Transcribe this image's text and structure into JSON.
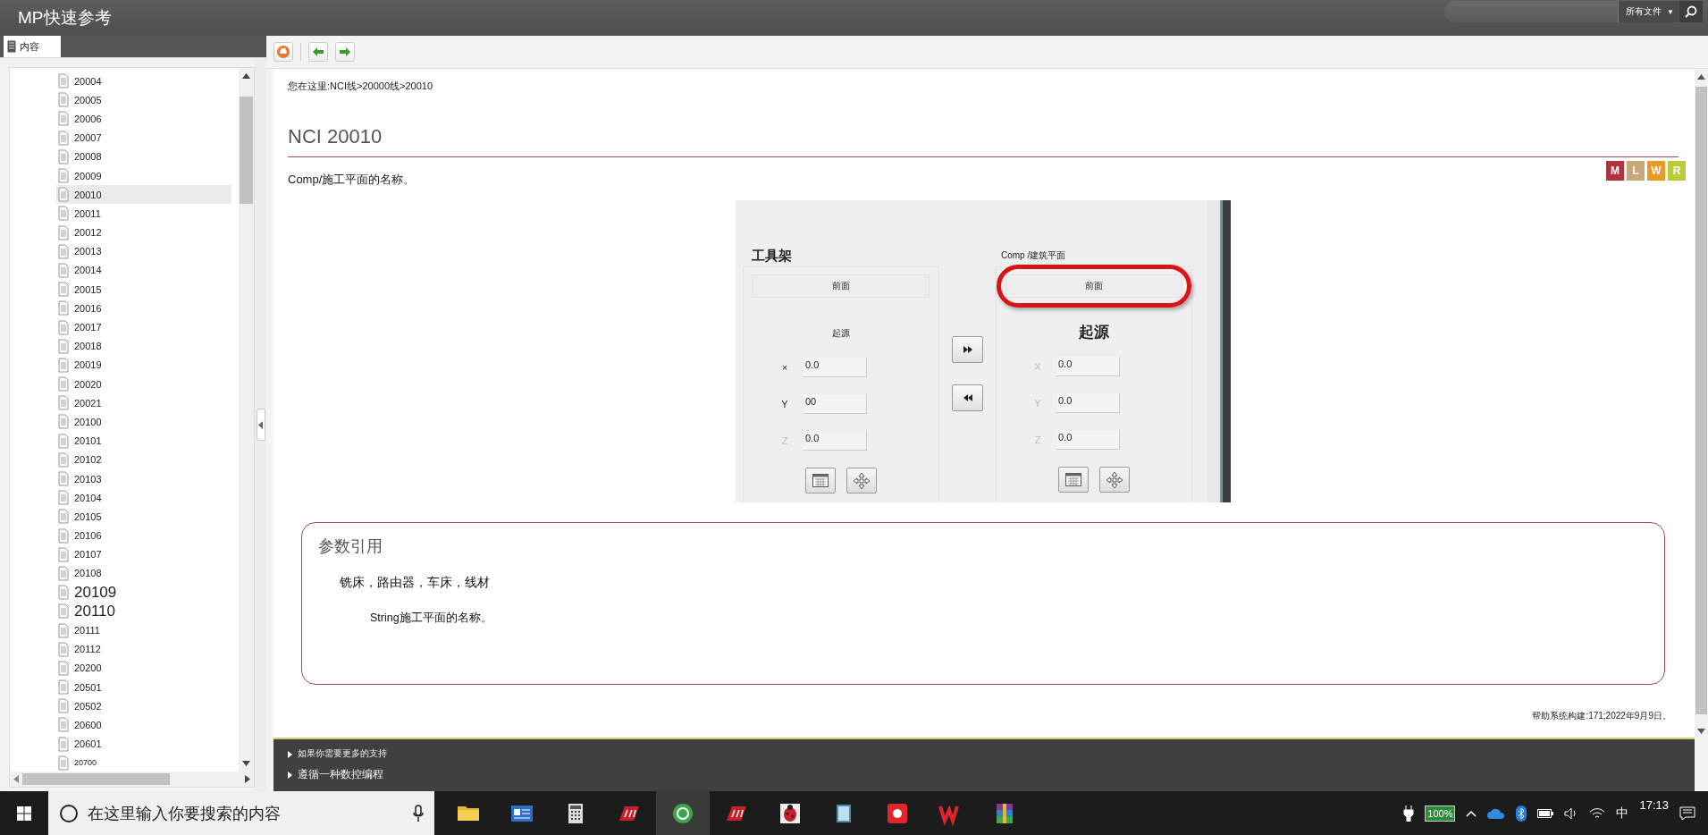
{
  "app": {
    "title": "MP快速参考"
  },
  "search": {
    "scope": "所有文件",
    "caret": "▼"
  },
  "left_tabs": [
    {
      "label": "内容",
      "selected": true
    }
  ],
  "tree": {
    "items": [
      {
        "label": "20004",
        "selected": false,
        "kind": "normal"
      },
      {
        "label": "20005",
        "selected": false,
        "kind": "normal"
      },
      {
        "label": "20006",
        "selected": false,
        "kind": "normal"
      },
      {
        "label": "20007",
        "selected": false,
        "kind": "normal"
      },
      {
        "label": "20008",
        "selected": false,
        "kind": "normal"
      },
      {
        "label": "20009",
        "selected": false,
        "kind": "normal"
      },
      {
        "label": "20010",
        "selected": true,
        "kind": "normal"
      },
      {
        "label": "20011",
        "selected": false,
        "kind": "normal"
      },
      {
        "label": "20012",
        "selected": false,
        "kind": "normal"
      },
      {
        "label": "20013",
        "selected": false,
        "kind": "normal"
      },
      {
        "label": "20014",
        "selected": false,
        "kind": "normal"
      },
      {
        "label": "20015",
        "selected": false,
        "kind": "normal"
      },
      {
        "label": "20016",
        "selected": false,
        "kind": "normal"
      },
      {
        "label": "20017",
        "selected": false,
        "kind": "normal"
      },
      {
        "label": "20018",
        "selected": false,
        "kind": "normal"
      },
      {
        "label": "20019",
        "selected": false,
        "kind": "normal"
      },
      {
        "label": "20020",
        "selected": false,
        "kind": "normal"
      },
      {
        "label": "20021",
        "selected": false,
        "kind": "normal"
      },
      {
        "label": "20100",
        "selected": false,
        "kind": "normal"
      },
      {
        "label": "20101",
        "selected": false,
        "kind": "normal"
      },
      {
        "label": "20102",
        "selected": false,
        "kind": "normal"
      },
      {
        "label": "20103",
        "selected": false,
        "kind": "normal"
      },
      {
        "label": "20104",
        "selected": false,
        "kind": "normal"
      },
      {
        "label": "20105",
        "selected": false,
        "kind": "normal"
      },
      {
        "label": "20106",
        "selected": false,
        "kind": "normal"
      },
      {
        "label": "20107",
        "selected": false,
        "kind": "normal"
      },
      {
        "label": "20108",
        "selected": false,
        "kind": "normal"
      },
      {
        "label": "20109",
        "selected": false,
        "kind": "large"
      },
      {
        "label": "20110",
        "selected": false,
        "kind": "large"
      },
      {
        "label": "20111",
        "selected": false,
        "kind": "normal"
      },
      {
        "label": "20112",
        "selected": false,
        "kind": "normal"
      },
      {
        "label": "20200",
        "selected": false,
        "kind": "normal"
      },
      {
        "label": "20501",
        "selected": false,
        "kind": "normal"
      },
      {
        "label": "20502",
        "selected": false,
        "kind": "normal"
      },
      {
        "label": "20600",
        "selected": false,
        "kind": "normal"
      },
      {
        "label": "20601",
        "selected": false,
        "kind": "normal"
      },
      {
        "label": "20700",
        "selected": false,
        "kind": "small"
      }
    ]
  },
  "breadcrumb": "您在这里:NCI线>20000线>20010",
  "heading": "NCI 20010",
  "badges": [
    {
      "label": "M",
      "color": "#b3323b"
    },
    {
      "label": "L",
      "color": "#c9a77a"
    },
    {
      "label": "W",
      "color": "#e99a26"
    },
    {
      "label": "R",
      "color": "#bccb3a"
    }
  ],
  "description": "Comp/施工平面的名称。",
  "figure": {
    "groups": [
      {
        "title": "工具架",
        "plane": "前面",
        "highlighted": false,
        "origin_label": "起源",
        "emphasis": false,
        "coords": [
          {
            "axis": "×",
            "value": "0.0",
            "disabled": false
          },
          {
            "axis": "Y",
            "value": "00",
            "disabled": false
          },
          {
            "axis": "Z",
            "value": "0.0",
            "disabled": true
          }
        ]
      },
      {
        "title": "Comp /建筑平面",
        "plane": "前面",
        "highlighted": true,
        "origin_label": "起源",
        "emphasis": true,
        "coords": [
          {
            "axis": "X",
            "value": "0.0",
            "disabled": true
          },
          {
            "axis": "Y",
            "value": "0.0",
            "disabled": true
          },
          {
            "axis": "Z",
            "value": "0.0",
            "disabled": true
          }
        ]
      }
    ]
  },
  "params": {
    "title": "参数引用",
    "machines": "铣床，路由器，车床，线材",
    "type_text": "String施工平面的名称。"
  },
  "build_info": "帮助系统构建:171;2022年9月9日。",
  "footer_links": [
    "如果你需要更多的支持",
    "遵循一种数控编程"
  ],
  "taskbar": {
    "search_placeholder": "在这里输入你要搜索的内容",
    "battery": "100%",
    "ime": "中",
    "time": "17:13"
  }
}
